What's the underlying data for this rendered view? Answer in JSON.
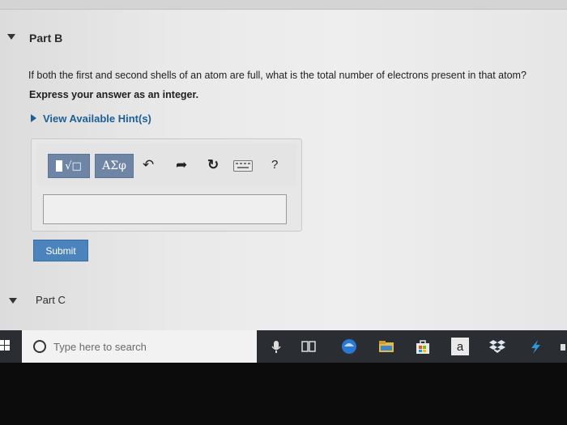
{
  "part_b": {
    "title": "Part B",
    "question": "If both the first and second shells of an atom are full, what is the total number of electrons present in that atom?",
    "instruction": "Express your answer as an integer.",
    "hint_link": "View Available Hint(s)"
  },
  "toolbar": {
    "templates_label": "√□",
    "symbols_label": "ΑΣφ",
    "undo_glyph": "↶",
    "redo_glyph": "➦",
    "reset_glyph": "↻",
    "help_label": "?"
  },
  "answer": {
    "value": ""
  },
  "submit_label": "Submit",
  "part_c": {
    "title": "Part C"
  },
  "taskbar": {
    "search_placeholder": "Type here to search",
    "amazon_label": "a"
  },
  "colors": {
    "hint_link": "#1b5f96",
    "submit_bg": "#4b83bd",
    "toolbar_button": "#6f85a6",
    "taskbar": "#2a2d32"
  }
}
